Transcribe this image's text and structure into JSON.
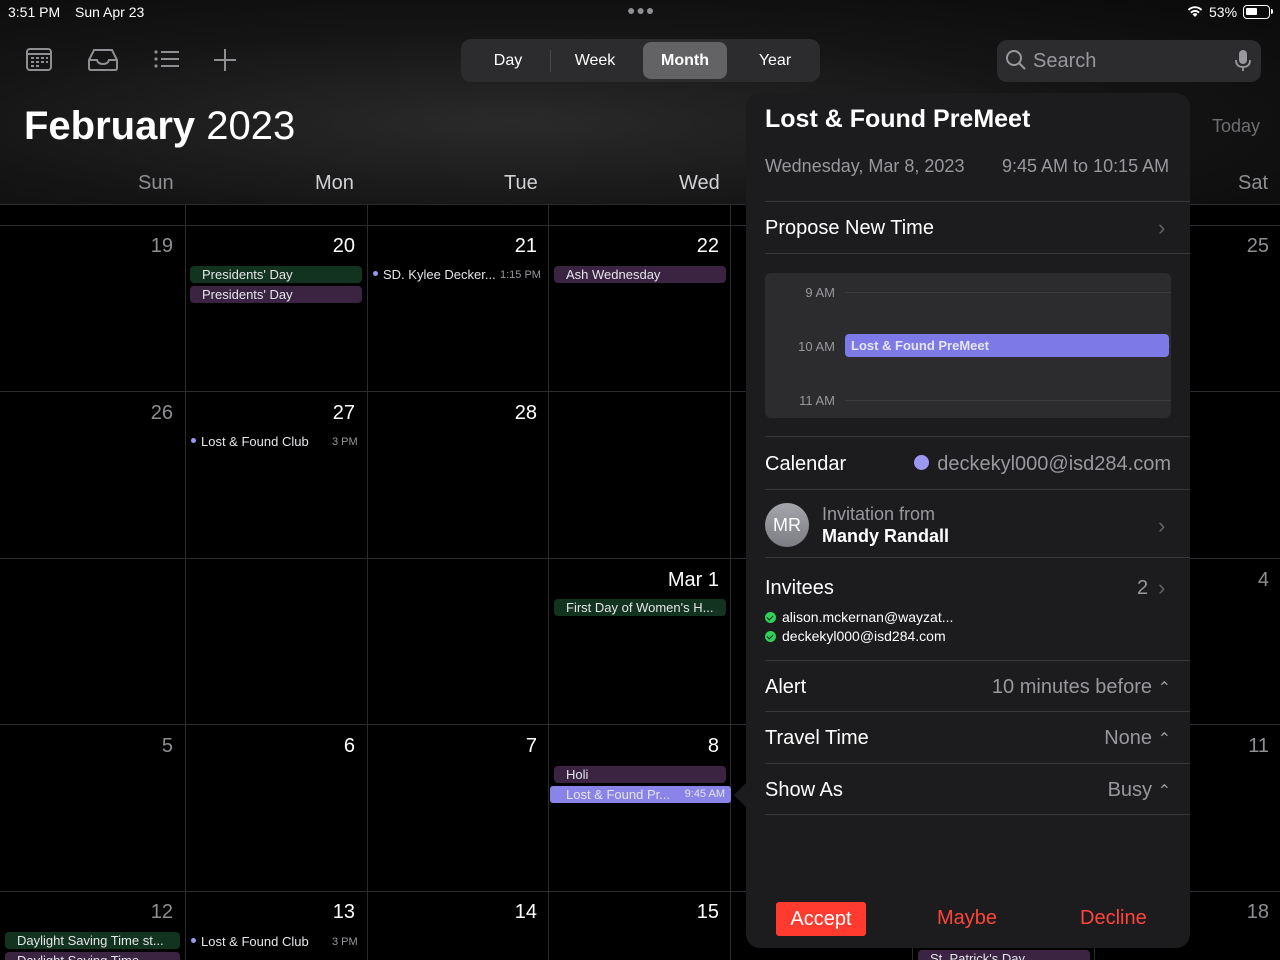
{
  "status": {
    "time": "3:51 PM",
    "date": "Sun Apr 23",
    "battery": "53%",
    "battery_level": 0.53
  },
  "toolbar": {
    "icons": [
      "calendar-grid-icon",
      "inbox-icon",
      "list-icon",
      "add-icon"
    ],
    "views": [
      {
        "label": "Day",
        "active": false
      },
      {
        "label": "Week",
        "active": false
      },
      {
        "label": "Month",
        "active": true
      },
      {
        "label": "Year",
        "active": false
      }
    ],
    "search_placeholder": "Search"
  },
  "header": {
    "month": "February",
    "year": "2023",
    "today_label": "Today"
  },
  "weekdays": [
    "Sun",
    "Mon",
    "Tue",
    "Wed",
    "Sat"
  ],
  "weeks": [
    {
      "days": [
        "19",
        "20",
        "21",
        "22",
        "25"
      ]
    },
    {
      "days": [
        "26",
        "27",
        "28",
        "",
        ""
      ]
    },
    {
      "days": [
        "",
        "",
        "",
        "Mar 1",
        "4"
      ]
    },
    {
      "days": [
        "5",
        "6",
        "7",
        "8",
        "11"
      ]
    },
    {
      "days": [
        "12",
        "13",
        "14",
        "15",
        "18"
      ]
    }
  ],
  "events": {
    "presidents_day_1": "Presidents' Day",
    "presidents_day_2": "Presidents' Day",
    "kylee": {
      "title": "SD. Kylee Decker...",
      "time": "1:15 PM"
    },
    "ash_wednesday": "Ash Wednesday",
    "club_27": {
      "title": "Lost & Found Club",
      "time": "3 PM"
    },
    "womens_history": "First Day of Women's H...",
    "holi": "Holi",
    "lost_found_8": {
      "title": "Lost & Found Pr...",
      "time": "9:45 AM"
    },
    "dst_1": "Daylight Saving Time st...",
    "dst_2": "Daylight Saving Time",
    "club_13": {
      "title": "Lost & Found Club",
      "time": "3 PM"
    },
    "st_patricks": "St. Patrick's Day"
  },
  "popover": {
    "title": "Lost & Found PreMeet",
    "date": "Wednesday, Mar 8, 2023",
    "time": "9:45 AM to 10:15 AM",
    "propose_label": "Propose New Time",
    "mini_cal": {
      "hours": [
        "9 AM",
        "10 AM",
        "11 AM"
      ],
      "event": "Lost & Found PreMeet"
    },
    "calendar_label": "Calendar",
    "calendar_value": "deckekyl000@isd284.com",
    "calendar_color": "#9a98f0",
    "avatar_initials": "MR",
    "invitation_from": "Invitation from",
    "organizer": "Mandy Randall",
    "invitees_label": "Invitees",
    "invitees_count": "2",
    "invitees": [
      "alison.mckernan@wayzat...",
      "deckekyl000@isd284.com"
    ],
    "alert_label": "Alert",
    "alert_value": "10 minutes before",
    "travel_label": "Travel Time",
    "travel_value": "None",
    "showas_label": "Show As",
    "showas_value": "Busy",
    "accept": "Accept",
    "maybe": "Maybe",
    "decline": "Decline"
  }
}
